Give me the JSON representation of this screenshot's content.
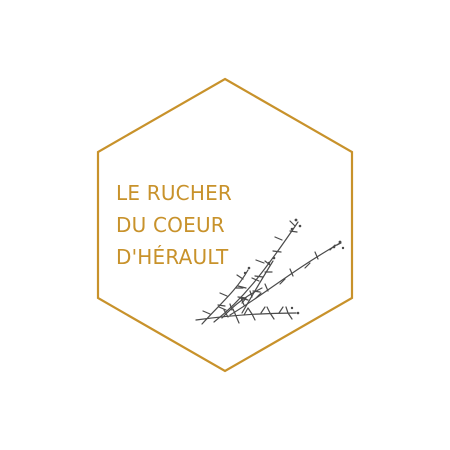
{
  "logo": {
    "title_lines": [
      "LE RUCHER",
      "DU COEUR",
      "D'HÉRAULT"
    ],
    "colors": {
      "accent": "#C8922B",
      "sprig": "#4A4A4A",
      "background": "#FFFFFF"
    },
    "icons": {
      "frame": "hexagon-outline",
      "sprig": "heather-sprig-icon"
    }
  }
}
